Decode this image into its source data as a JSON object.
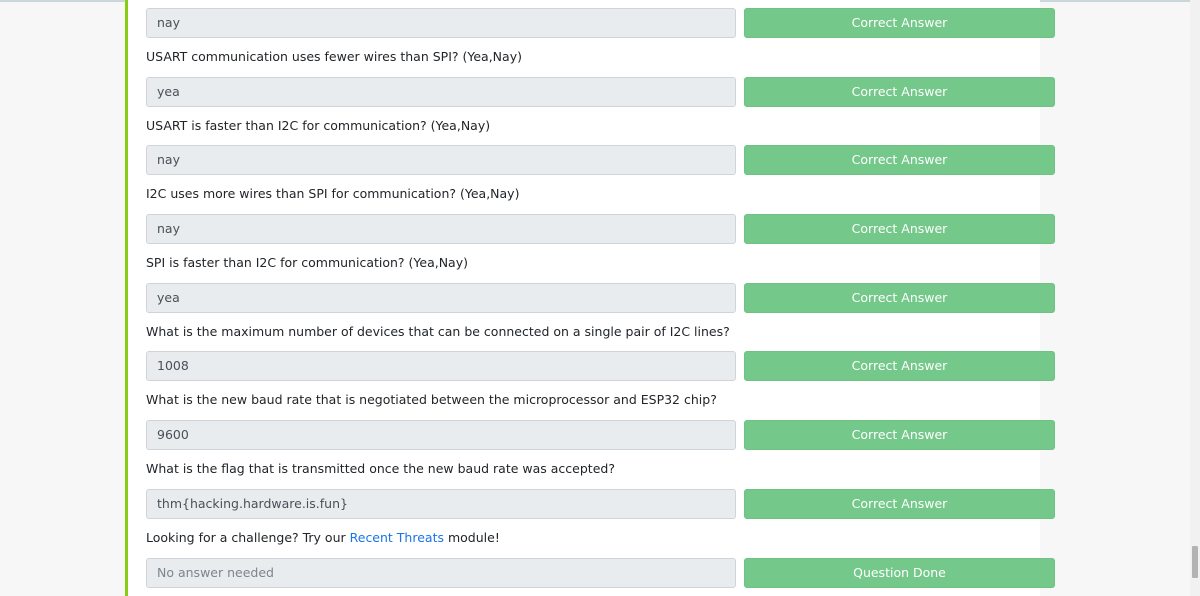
{
  "rows": [
    {
      "answer": "nay",
      "button": "Correct Answer"
    },
    {
      "question": "USART communication uses fewer wires than SPI? (Yea,Nay)",
      "answer": "yea",
      "button": "Correct Answer"
    },
    {
      "question": "USART is faster than I2C for communication? (Yea,Nay)",
      "answer": "nay",
      "button": "Correct Answer"
    },
    {
      "question": "I2C uses more wires than SPI for communication? (Yea,Nay)",
      "answer": "nay",
      "button": "Correct Answer"
    },
    {
      "question": "SPI is faster than I2C for communication? (Yea,Nay)",
      "answer": "yea",
      "button": "Correct Answer"
    },
    {
      "question": "What is the maximum number of devices that can be connected on a single pair of I2C lines?",
      "answer": "1008",
      "button": "Correct Answer"
    },
    {
      "question": "What is the new baud rate that is negotiated between the microprocessor and ESP32 chip?",
      "answer": "9600",
      "button": "Correct Answer"
    },
    {
      "question": "What is the flag that is transmitted once the new baud rate was accepted?",
      "answer": "thm{hacking.hardware.is.fun}",
      "button": "Correct Answer"
    }
  ],
  "final": {
    "question_prefix": "Looking for a challenge? Try our ",
    "link_text": "Recent Threats",
    "question_suffix": " module!",
    "answer_placeholder": "No answer needed",
    "button": "Question Done"
  },
  "colors": {
    "accent_bar": "#88cc14",
    "button_green": "#74c88a",
    "link_blue": "#1a73e8"
  }
}
